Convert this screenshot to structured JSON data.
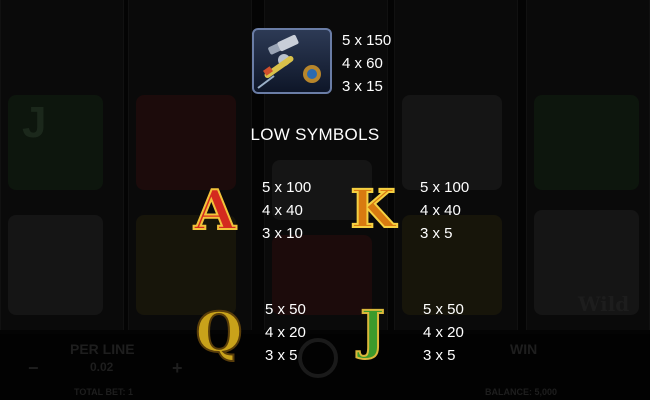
{
  "paytable": {
    "high_symbol": {
      "icon": "tattoo-machine-icon",
      "payouts": [
        "5 x 150",
        "4 x 60",
        "3 x 15"
      ]
    },
    "low_heading": "LOW SYMBOLS",
    "low_symbols": [
      {
        "icon": "letter-a-symbol",
        "glyph": "A",
        "payouts": [
          "5 x 100",
          "4 x 40",
          "3 x 10"
        ]
      },
      {
        "icon": "letter-k-symbol",
        "glyph": "K",
        "payouts": [
          "5 x 100",
          "4 x 40",
          "3 x 5"
        ]
      },
      {
        "icon": "letter-q-symbol",
        "glyph": "Q",
        "payouts": [
          "5 x 50",
          "4 x 20",
          "3 x 5"
        ]
      },
      {
        "icon": "letter-j-symbol",
        "glyph": "J",
        "payouts": [
          "5 x 50",
          "4 x 20",
          "3 x 5"
        ]
      }
    ]
  },
  "background_hud": {
    "per_line_label": "PER LINE",
    "per_line_value": "0.02",
    "minus": "−",
    "plus": "+",
    "total_bet": "TOTAL BET: 1",
    "win_label": "WIN",
    "balance": "BALANCE: 5,000",
    "wild_text": "Wild"
  },
  "colors": {
    "a": "#d42a1f",
    "k": "#d87a10",
    "q": "#c9a21a",
    "j": "#3c9a2c"
  }
}
